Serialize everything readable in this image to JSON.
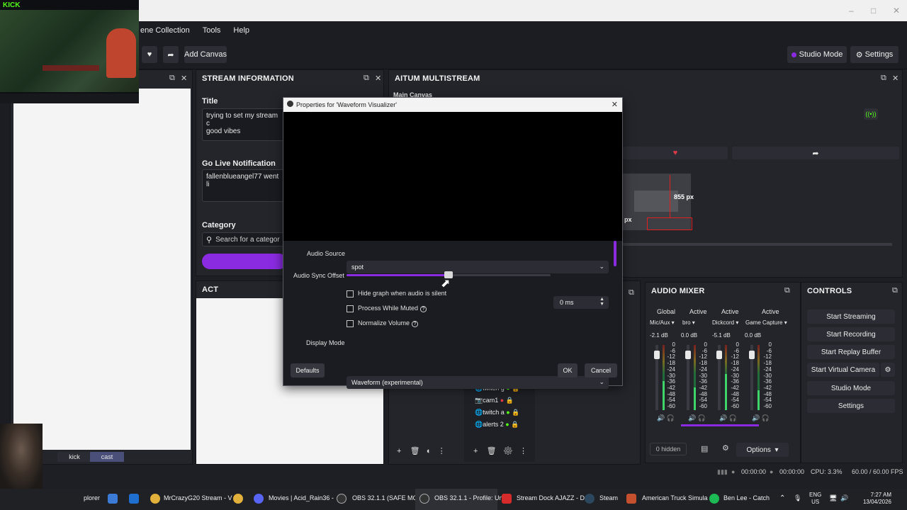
{
  "colors": {
    "accent": "#8a2be2",
    "kick_green": "#53fc18",
    "background": "#1e1f24",
    "panel": "#24252b"
  },
  "menubar": {
    "items": [
      "ene Collection",
      "Tools",
      "Help"
    ]
  },
  "toolbar": {
    "add_canvas": "Add Canvas",
    "studio_mode": "Studio Mode",
    "settings": "Settings"
  },
  "stream_info": {
    "heading": "STREAM INFORMATION",
    "title_label": "Title",
    "title_value_line1": "trying to set my stream c",
    "title_value_line2": "good vibes",
    "go_live_label": "Go Live Notification",
    "go_live_value": "fallenblueangel77 went li",
    "category_label": "Category",
    "category_placeholder": "Search for a categor"
  },
  "act_dock": {
    "heading": "ACT"
  },
  "multistream": {
    "heading": "AITUM MULTISTREAM",
    "canvas_label": "Main Canvas",
    "px_h": "855 px",
    "px_w": "px"
  },
  "dialog": {
    "title": "Properties for 'Waveform Visualizer'",
    "audio_source_label": "Audio Source",
    "audio_source_value": "spot",
    "sync_offset_label": "Audio Sync Offset",
    "sync_offset_value": "0 ms",
    "hide_graph_label": "Hide graph when audio is silent",
    "process_muted_label": "Process While Muted",
    "normalize_label": "Normalize Volume",
    "display_mode_label": "Display Mode",
    "display_mode_value": "Waveform (experimental)",
    "defaults": "Defaults",
    "ok": "OK",
    "cancel": "Cancel"
  },
  "sources": {
    "items": [
      "twitch g",
      "cam1",
      "twitch a",
      "alerts 2"
    ]
  },
  "audio_mixer": {
    "heading": "AUDIO MIXER",
    "states": [
      "Global",
      "Active",
      "Active",
      "Active"
    ],
    "channels": [
      "Mic/Aux",
      "bro",
      "Dickcord",
      "Game Capture"
    ],
    "db": [
      "-2.1 dB",
      "0.0 dB",
      "-5.1 dB",
      "0.0 dB"
    ],
    "scale": [
      "0",
      "-6",
      "-12",
      "-18",
      "-24",
      "-30",
      "-36",
      "-42",
      "-48",
      "-54",
      "-60"
    ],
    "hidden": "0 hidden",
    "options": "Options"
  },
  "controls": {
    "heading": "CONTROLS",
    "buttons": [
      "Start Streaming",
      "Start Recording",
      "Start Replay Buffer",
      "Start Virtual Camera",
      "Studio Mode",
      "Settings"
    ]
  },
  "status": {
    "time1": "00:00:00",
    "time2": "00:00:00",
    "cpu": "CPU: 3.3%",
    "fps": "60.00 / 60.00 FPS"
  },
  "overlay": {
    "kick_logo": "KICK",
    "tab_kick": "kick",
    "tab_cast": "cast"
  },
  "taskbar": {
    "items": [
      "plorer",
      "MrCrazyG20 Stream - V",
      "Movies | Acid_Rain36 -",
      "OBS 32.1.1 (SAFE MODE",
      "OBS 32.1.1 - Profile: Unt",
      "Stream Dock AJAZZ - D",
      "Steam",
      "American Truck Simula",
      "Ben Lee - Catch"
    ],
    "lang1": "ENG",
    "lang2": "US",
    "clock_time": "7:27 AM",
    "clock_date": "13/04/2026"
  }
}
